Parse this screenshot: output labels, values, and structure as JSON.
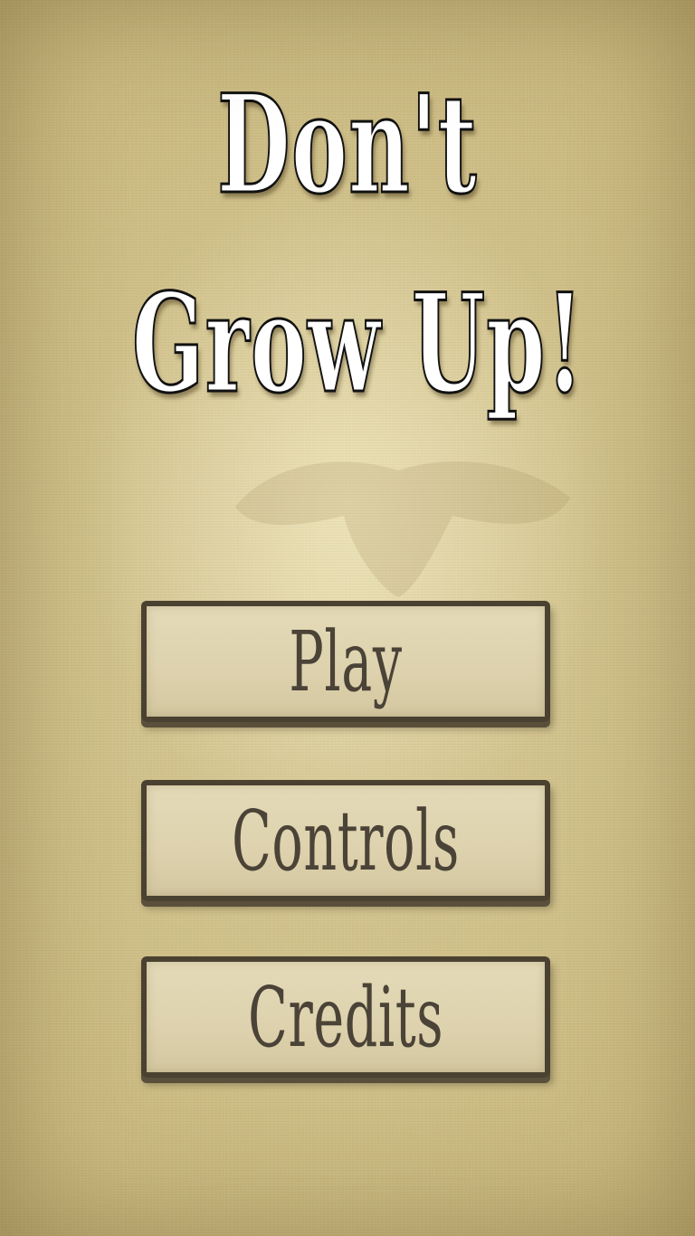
{
  "title": {
    "line1": "Don't",
    "line2": "Grow Up!"
  },
  "menu": {
    "play_label": "Play",
    "controls_label": "Controls",
    "credits_label": "Credits"
  },
  "colors": {
    "background": "#d1c38c",
    "button_face": "#e0d6b2",
    "button_border": "#4a4131",
    "button_text": "#4b4337",
    "title_fill": "#ffffff",
    "title_outline": "#111111"
  }
}
